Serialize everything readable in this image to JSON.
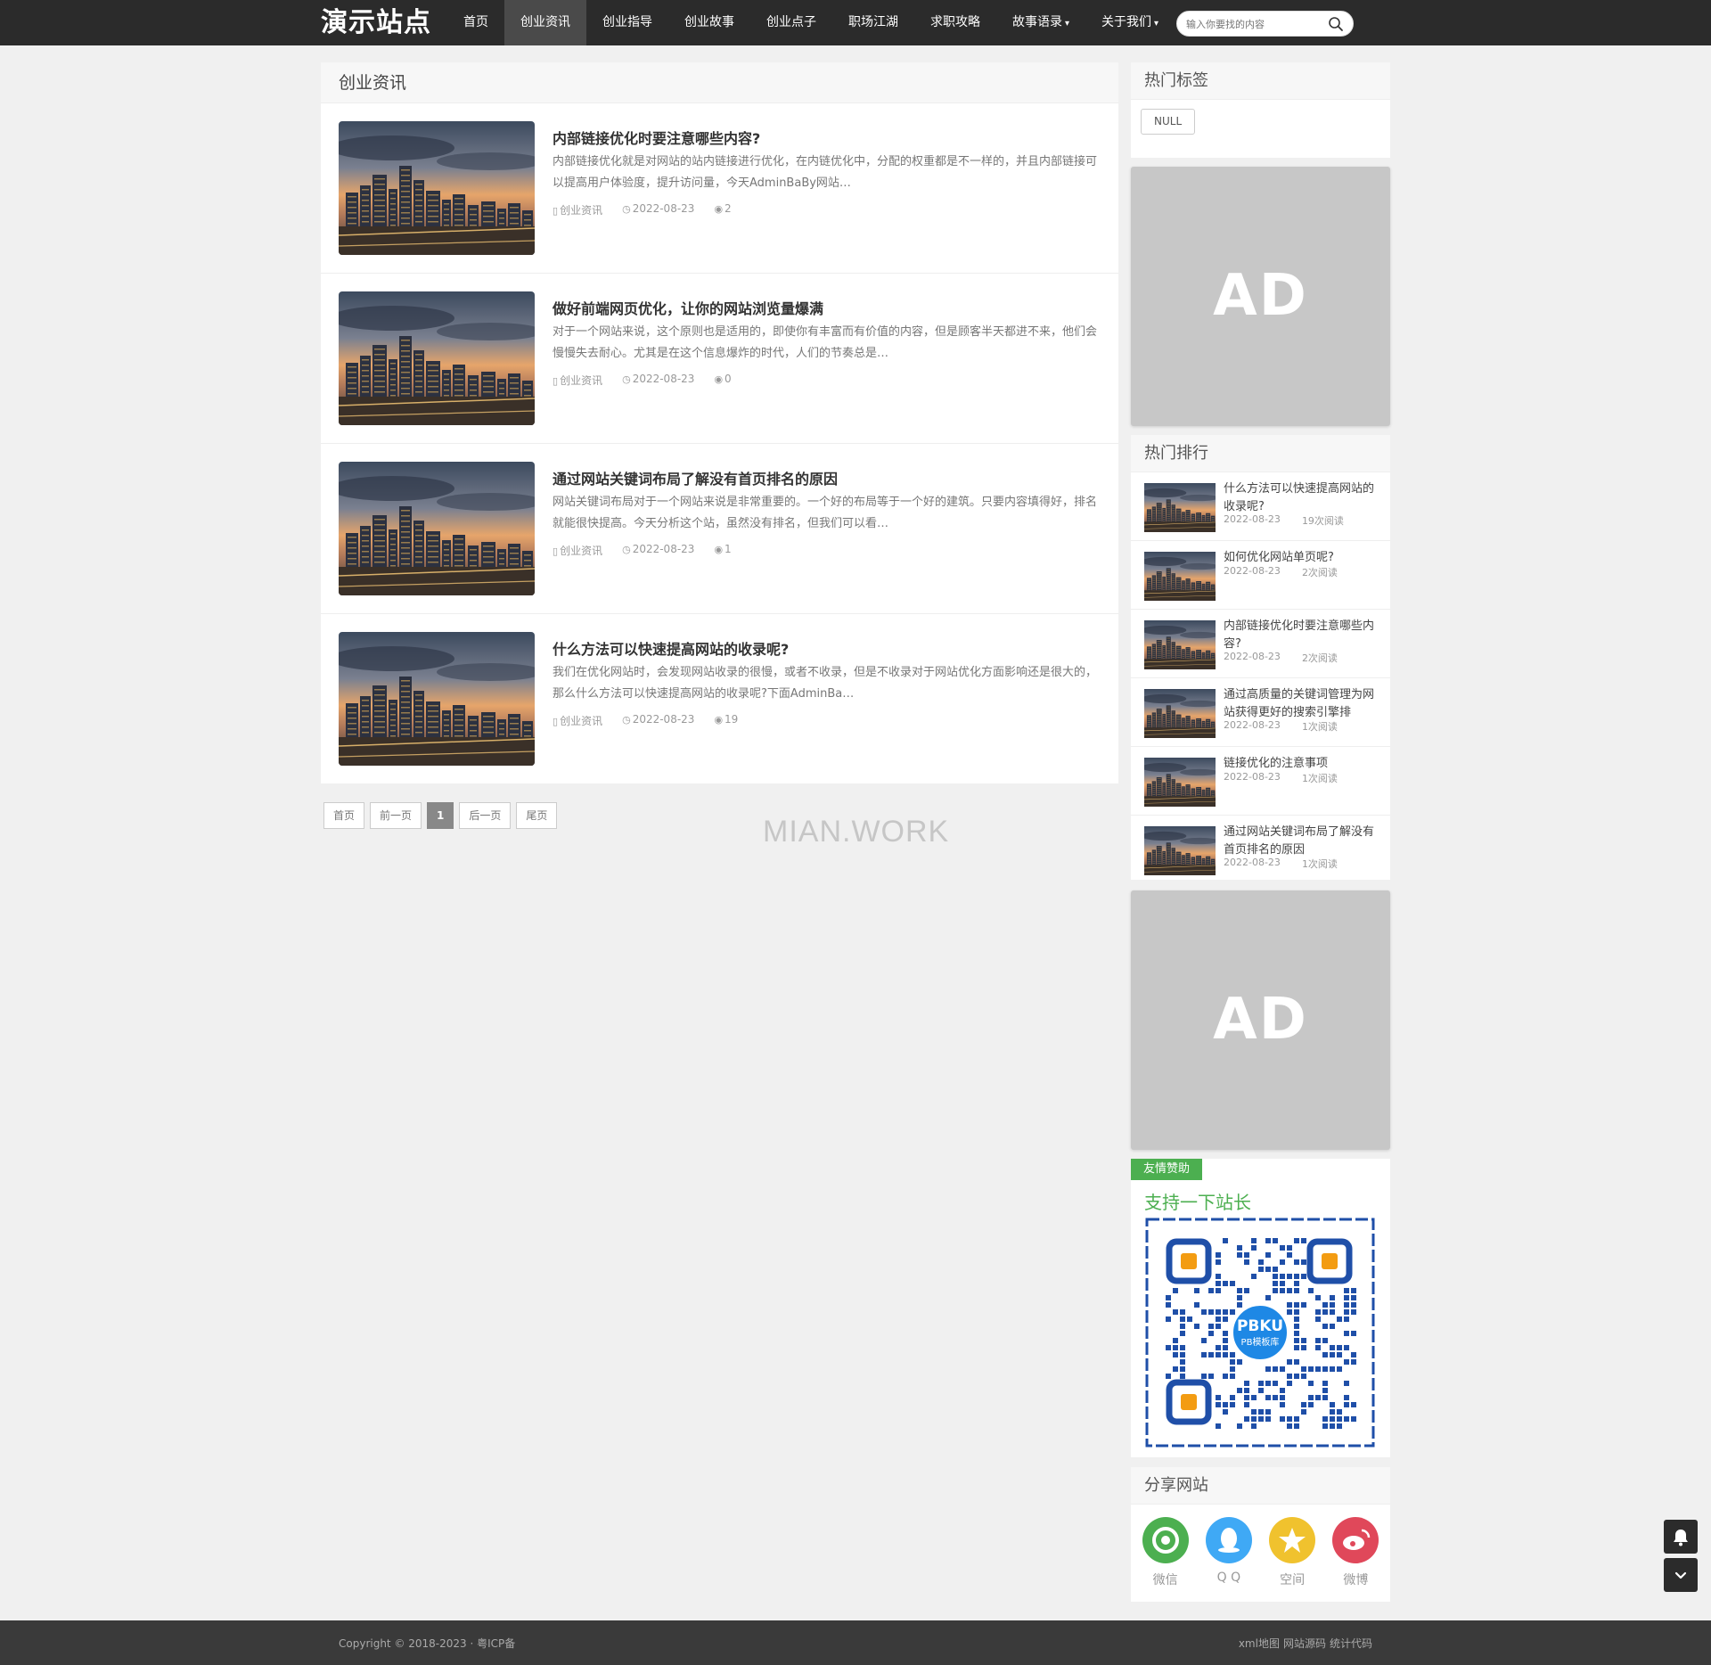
{
  "header": {
    "logo": "演示站点",
    "nav": [
      "首页",
      "创业资讯",
      "创业指导",
      "创业故事",
      "创业点子",
      "职场江湖",
      "求职攻略",
      "故事语录",
      "关于我们"
    ],
    "active_index": 1,
    "dropdown_items": [
      7,
      8
    ],
    "search_placeholder": "输入你要找的内容"
  },
  "main": {
    "section_title": "创业资讯",
    "posts": [
      {
        "title": "内部链接优化时要注意哪些内容?",
        "excerpt": "内部链接优化就是对网站的站内链接进行优化，在内链优化中，分配的权重都是不一样的，并且内部链接可以提高用户体验度，提升访问量，今天AdminBaBy网站…",
        "category": "创业资讯",
        "date": "2022-08-23",
        "views": "2"
      },
      {
        "title": "做好前端网页优化，让你的网站浏览量爆满",
        "excerpt": "对于一个网站来说，这个原则也是适用的，即使你有丰富而有价值的内容，但是顾客半天都进不来，他们会慢慢失去耐心。尤其是在这个信息爆炸的时代，人们的节奏总是…",
        "category": "创业资讯",
        "date": "2022-08-23",
        "views": "0"
      },
      {
        "title": "通过网站关键词布局了解没有首页排名的原因",
        "excerpt": "网站关键词布局对于一个网站来说是非常重要的。一个好的布局等于一个好的建筑。只要内容填得好，排名就能很快提高。今天分析这个站，虽然没有排名，但我们可以看…",
        "category": "创业资讯",
        "date": "2022-08-23",
        "views": "1"
      },
      {
        "title": "什么方法可以快速提高网站的收录呢?",
        "excerpt": "我们在优化网站时，会发现网站收录的很慢，或者不收录，但是不收录对于网站优化方面影响还是很大的，那么什么方法可以快速提高网站的收录呢?下面AdminBa…",
        "category": "创业资讯",
        "date": "2022-08-23",
        "views": "19"
      }
    ]
  },
  "pager": {
    "first": "首页",
    "prev": "前一页",
    "current": "1",
    "next": "后一页",
    "last": "尾页"
  },
  "watermark": "MIAN.WORK",
  "sidebar": {
    "tags_title": "热门标签",
    "tags": [
      "NULL"
    ],
    "ad_text": "AD",
    "rank_title": "热门排行",
    "rank": [
      {
        "title": "什么方法可以快速提高网站的收录呢?",
        "date": "2022-08-23",
        "reads": "19次阅读"
      },
      {
        "title": "如何优化网站单页呢?",
        "date": "2022-08-23",
        "reads": "2次阅读"
      },
      {
        "title": "内部链接优化时要注意哪些内容?",
        "date": "2022-08-23",
        "reads": "2次阅读"
      },
      {
        "title": "通过高质量的关键词管理为网站获得更好的搜索引擎排",
        "date": "2022-08-23",
        "reads": "1次阅读"
      },
      {
        "title": "链接优化的注意事项",
        "date": "2022-08-23",
        "reads": "1次阅读"
      },
      {
        "title": "通过网站关键词布局了解没有首页排名的原因",
        "date": "2022-08-23",
        "reads": "1次阅读"
      }
    ],
    "donate_badge": "友情赞助",
    "donate_title": "支持一下站长",
    "qr_logo_main": "PBKU",
    "qr_logo_sub": "PB模板库",
    "share_title": "分享网站",
    "share": [
      {
        "label": "微信",
        "icon": "wechat-icon",
        "color": "#4caf50"
      },
      {
        "label": "Q Q",
        "icon": "qq-icon",
        "color": "#3fa9f5"
      },
      {
        "label": "空间",
        "icon": "qzone-icon",
        "color": "#f0c22e"
      },
      {
        "label": "微博",
        "icon": "weibo-icon",
        "color": "#e0485a"
      }
    ]
  },
  "footer": {
    "copyright": "Copyright © 2018-2023 · 粤ICP备",
    "links": [
      "xml地图",
      "网站源码",
      "统计代码"
    ]
  },
  "colors": {
    "topbar": "#2b2b2b",
    "accent_green": "#4caf50",
    "ad_gray": "#c7c7c7"
  }
}
